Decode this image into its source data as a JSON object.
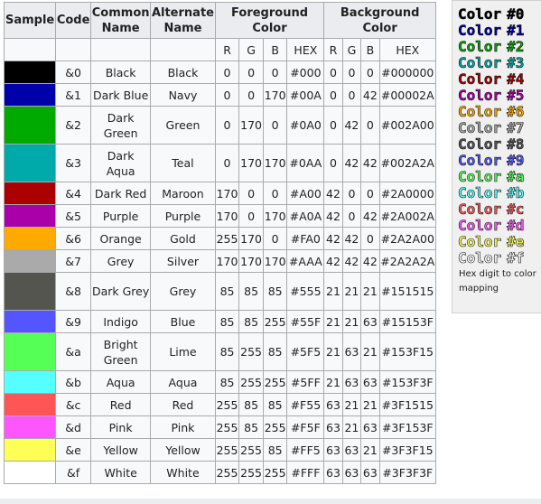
{
  "headers": {
    "sample": "Sample",
    "code": "Code",
    "common_name": "Common Name",
    "alternate_name": "Alternate Name",
    "foreground": "Foreground Color",
    "background": "Background Color",
    "r": "R",
    "g": "G",
    "b": "B",
    "hex": "HEX"
  },
  "rows": [
    {
      "code": "&0",
      "common": "Black",
      "alt": "Black",
      "fr": "0",
      "fg": "0",
      "fb": "0",
      "fhex": "#000",
      "br": "0",
      "bg": "0",
      "bb": "0",
      "bhex": "#000000",
      "swatch": "#000000"
    },
    {
      "code": "&1",
      "common": "Dark Blue",
      "alt": "Navy",
      "fr": "0",
      "fg": "0",
      "fb": "170",
      "fhex": "#00A",
      "br": "0",
      "bg": "0",
      "bb": "42",
      "bhex": "#00002A",
      "swatch": "#0000aa"
    },
    {
      "code": "&2",
      "common": "Dark Green",
      "alt": "Green",
      "fr": "0",
      "fg": "170",
      "fb": "0",
      "fhex": "#0A0",
      "br": "0",
      "bg": "42",
      "bb": "0",
      "bhex": "#002A00",
      "swatch": "#00aa00"
    },
    {
      "code": "&3",
      "common": "Dark Aqua",
      "alt": "Teal",
      "fr": "0",
      "fg": "170",
      "fb": "170",
      "fhex": "#0AA",
      "br": "0",
      "bg": "42",
      "bb": "42",
      "bhex": "#002A2A",
      "swatch": "#00aaaa"
    },
    {
      "code": "&4",
      "common": "Dark Red",
      "alt": "Maroon",
      "fr": "170",
      "fg": "0",
      "fb": "0",
      "fhex": "#A00",
      "br": "42",
      "bg": "0",
      "bb": "0",
      "bhex": "#2A0000",
      "swatch": "#aa0000"
    },
    {
      "code": "&5",
      "common": "Purple",
      "alt": "Purple",
      "fr": "170",
      "fg": "0",
      "fb": "170",
      "fhex": "#A0A",
      "br": "42",
      "bg": "0",
      "bb": "42",
      "bhex": "#2A002A",
      "swatch": "#aa00aa"
    },
    {
      "code": "&6",
      "common": "Orange",
      "alt": "Gold",
      "fr": "255",
      "fg": "170",
      "fb": "0",
      "fhex": "#FA0",
      "br": "42",
      "bg": "42",
      "bb": "0",
      "bhex": "#2A2A00",
      "swatch": "#ffaa00"
    },
    {
      "code": "&7",
      "common": "Grey",
      "alt": "Silver",
      "fr": "170",
      "fg": "170",
      "fb": "170",
      "fhex": "#AAA",
      "br": "42",
      "bg": "42",
      "bb": "42",
      "bhex": "#2A2A2A",
      "swatch": "#aaaaaa"
    },
    {
      "code": "&8",
      "common": "Dark Grey",
      "alt": "Grey",
      "fr": "85",
      "fg": "85",
      "fb": "85",
      "fhex": "#555",
      "br": "21",
      "bg": "21",
      "bb": "21",
      "bhex": "#151515",
      "swatch": "#555550"
    },
    {
      "code": "&9",
      "common": "Indigo",
      "alt": "Blue",
      "fr": "85",
      "fg": "85",
      "fb": "255",
      "fhex": "#55F",
      "br": "21",
      "bg": "21",
      "bb": "63",
      "bhex": "#15153F",
      "swatch": "#5555ff"
    },
    {
      "code": "&a",
      "common": "Bright Green",
      "alt": "Lime",
      "fr": "85",
      "fg": "255",
      "fb": "85",
      "fhex": "#5F5",
      "br": "21",
      "bg": "63",
      "bb": "21",
      "bhex": "#153F15",
      "swatch": "#55ff55"
    },
    {
      "code": "&b",
      "common": "Aqua",
      "alt": "Aqua",
      "fr": "85",
      "fg": "255",
      "fb": "255",
      "fhex": "#5FF",
      "br": "21",
      "bg": "63",
      "bb": "63",
      "bhex": "#153F3F",
      "swatch": "#55ffff"
    },
    {
      "code": "&c",
      "common": "Red",
      "alt": "Red",
      "fr": "255",
      "fg": "85",
      "fb": "85",
      "fhex": "#F55",
      "br": "63",
      "bg": "21",
      "bb": "21",
      "bhex": "#3F1515",
      "swatch": "#ff5555"
    },
    {
      "code": "&d",
      "common": "Pink",
      "alt": "Pink",
      "fr": "255",
      "fg": "85",
      "fb": "255",
      "fhex": "#F5F",
      "br": "63",
      "bg": "21",
      "bb": "63",
      "bhex": "#3F153F",
      "swatch": "#ff55ff"
    },
    {
      "code": "&e",
      "common": "Yellow",
      "alt": "Yellow",
      "fr": "255",
      "fg": "255",
      "fb": "85",
      "fhex": "#FF5",
      "br": "63",
      "bg": "63",
      "bb": "21",
      "bhex": "#3F3F15",
      "swatch": "#ffff55"
    },
    {
      "code": "&f",
      "common": "White",
      "alt": "White",
      "fr": "255",
      "fg": "255",
      "fb": "255",
      "fhex": "#FFF",
      "br": "63",
      "bg": "63",
      "bb": "63",
      "bhex": "#3F3F3F",
      "swatch": "#ffffff"
    }
  ],
  "sidebar": {
    "word": "Color",
    "items": [
      {
        "code": "#0",
        "color": "#000000"
      },
      {
        "code": "#1",
        "color": "#0000aa"
      },
      {
        "code": "#2",
        "color": "#00aa00"
      },
      {
        "code": "#3",
        "color": "#00aaaa"
      },
      {
        "code": "#4",
        "color": "#aa0000"
      },
      {
        "code": "#5",
        "color": "#aa00aa"
      },
      {
        "code": "#6",
        "color": "#ffaa00"
      },
      {
        "code": "#7",
        "color": "#aaaaaa"
      },
      {
        "code": "#8",
        "color": "#555555"
      },
      {
        "code": "#9",
        "color": "#5555ff"
      },
      {
        "code": "#a",
        "color": "#55ff55"
      },
      {
        "code": "#b",
        "color": "#55ffff"
      },
      {
        "code": "#c",
        "color": "#ff5555"
      },
      {
        "code": "#d",
        "color": "#ff55ff"
      },
      {
        "code": "#e",
        "color": "#ffff55"
      },
      {
        "code": "#f",
        "color": "#ffffff"
      }
    ],
    "caption": "Hex digit to color mapping"
  }
}
